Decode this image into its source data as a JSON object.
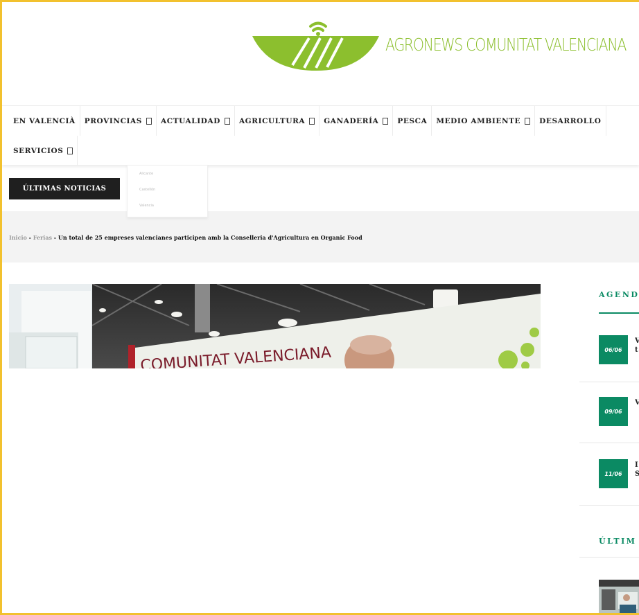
{
  "brand": {
    "name": "AGRONEWS COMUNITAT VALENCIANA",
    "colors": {
      "green": "#8cbf2e",
      "teal": "#0a8a63",
      "dark": "#1f1f1f",
      "frame": "#f2c12e"
    }
  },
  "nav": {
    "row1": [
      {
        "label": "EN VALENCIÀ",
        "dropdown": false
      },
      {
        "label": "PROVINCIAS",
        "dropdown": true
      },
      {
        "label": "ACTUALIDAD",
        "dropdown": true
      },
      {
        "label": "AGRICULTURA",
        "dropdown": true
      },
      {
        "label": "GANADERÍA",
        "dropdown": true
      },
      {
        "label": "PESCA",
        "dropdown": false
      },
      {
        "label": "MEDIO AMBIENTE",
        "dropdown": true
      },
      {
        "label": "DESARROLLO",
        "dropdown": false
      }
    ],
    "row2": [
      {
        "label": "SERVICIOS",
        "dropdown": true
      }
    ],
    "dropdown_items": [
      "Alicante",
      "Castellón",
      "Valencia"
    ]
  },
  "latest_news_button": "ÚLTIMAS NOTICIAS",
  "breadcrumb": {
    "home": "Inicio",
    "sep": " - ",
    "section": "Ferias",
    "current": "Un total de 25 empreses valencianes participen amb la Conselleria d'Agricultura en Organic Food"
  },
  "hero": {
    "sign_text": "COMUNITAT VALENCIANA"
  },
  "sidebar": {
    "agenda_title": "AGEND",
    "agenda": [
      {
        "date": "06/06",
        "text": "V\nt"
      },
      {
        "date": "09/06",
        "text": "V"
      },
      {
        "date": "11/06",
        "text": "I\nS"
      }
    ],
    "latest_title": "ÚLTIM"
  }
}
